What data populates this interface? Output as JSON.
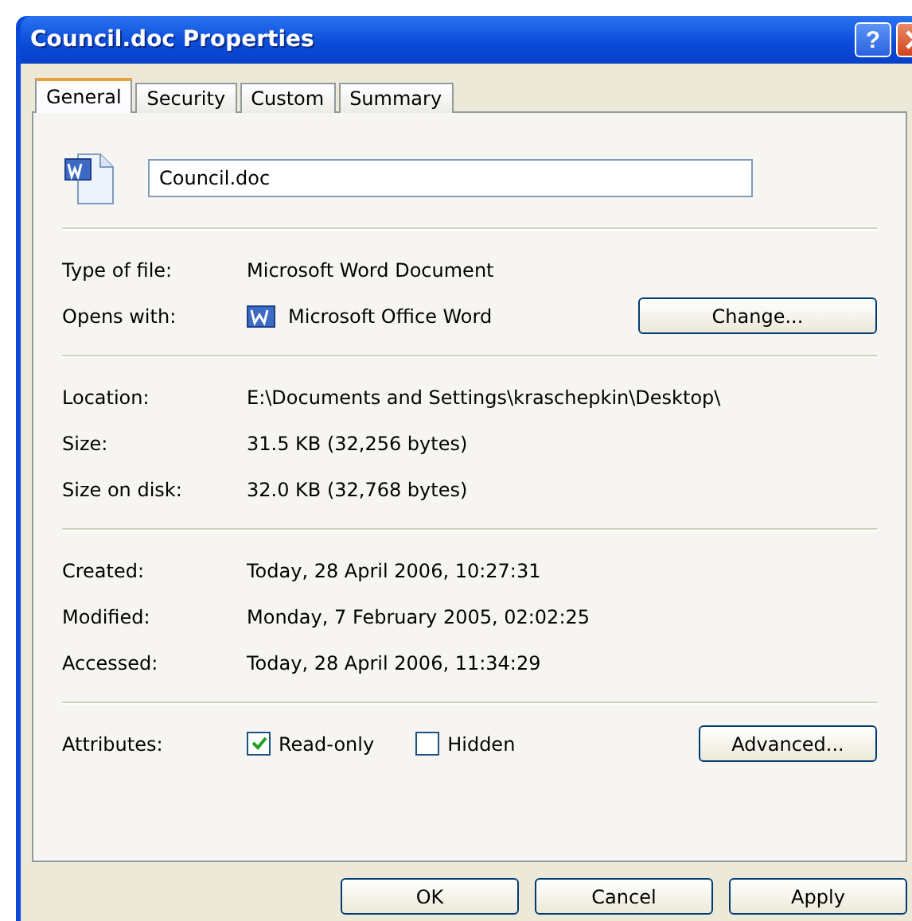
{
  "window": {
    "title": "Council.doc Properties",
    "help": "?"
  },
  "tabs": [
    {
      "label": "General",
      "selected": true
    },
    {
      "label": "Security",
      "selected": false
    },
    {
      "label": "Custom",
      "selected": false
    },
    {
      "label": "Summary",
      "selected": false
    }
  ],
  "file_name": {
    "value": "Council.doc"
  },
  "groups": [
    [
      {
        "kind": "text",
        "label": "Type of file:",
        "value": "Microsoft Word Document"
      },
      {
        "kind": "app",
        "label": "Opens with:",
        "value": "Microsoft Office Word",
        "button": "Change..."
      }
    ],
    [
      {
        "kind": "text",
        "label": "Location:",
        "value": "E:\\Documents and Settings\\kraschepkin\\Desktop\\"
      },
      {
        "kind": "text",
        "label": "Size:",
        "value": "31.5 KB (32,256 bytes)"
      },
      {
        "kind": "text",
        "label": "Size on disk:",
        "value": "32.0 KB (32,768 bytes)"
      }
    ],
    [
      {
        "kind": "text",
        "label": "Created:",
        "value": "Today, 28 April 2006, 10:27:31"
      },
      {
        "kind": "text",
        "label": "Modified:",
        "value": "Monday, 7 February 2005, 02:02:25"
      },
      {
        "kind": "text",
        "label": "Accessed:",
        "value": "Today, 28 April 2006, 11:34:29"
      }
    ]
  ],
  "attributes": {
    "label": "Attributes:",
    "checkboxes": [
      {
        "label": "Read-only",
        "checked": true
      },
      {
        "label": "Hidden",
        "checked": false
      }
    ],
    "button": "Advanced..."
  },
  "buttons": [
    "OK",
    "Cancel",
    "Apply"
  ]
}
